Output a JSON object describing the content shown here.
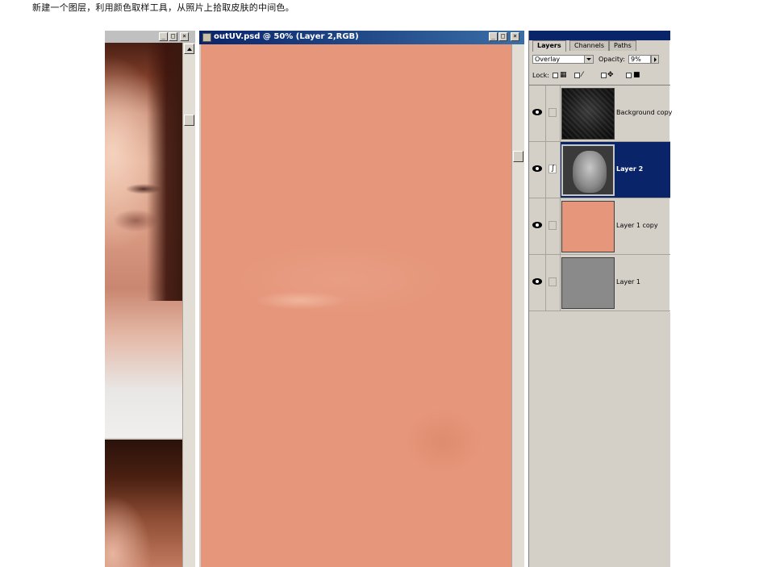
{
  "caption": "新建一个图层，利用颜色取样工具，从照片上拾取皮肤的中间色。",
  "photo_window": {
    "controls": {
      "minimize": "_",
      "maximize": "□",
      "close": "×"
    }
  },
  "document_window": {
    "title": "outUV.psd @ 50% (Layer 2,RGB)",
    "canvas_color": "#e6967a",
    "controls": {
      "minimize": "_",
      "maximize": "□",
      "close": "×"
    }
  },
  "layers_palette": {
    "tabs": [
      {
        "label": "Layers",
        "active": true
      },
      {
        "label": "Channels",
        "active": false
      },
      {
        "label": "Paths",
        "active": false
      }
    ],
    "blend_mode": "Overlay",
    "opacity_label": "Opacity:",
    "opacity_value": "9%",
    "lock_label": "Lock:",
    "layers": [
      {
        "name": "Background copy",
        "visible": true,
        "selected": false,
        "thumb": "dark-texture"
      },
      {
        "name": "Layer 2",
        "visible": true,
        "selected": true,
        "thumb": "gray-face"
      },
      {
        "name": "Layer 1 copy",
        "visible": true,
        "selected": false,
        "thumb_color": "#e6967a"
      },
      {
        "name": "Layer 1",
        "visible": true,
        "selected": false,
        "thumb_color": "#8a8a8a"
      }
    ]
  },
  "colors": {
    "title_active": "#0a246a",
    "selection": "#0a246a",
    "chrome": "#d4d0c8",
    "skin": "#e6967a"
  }
}
